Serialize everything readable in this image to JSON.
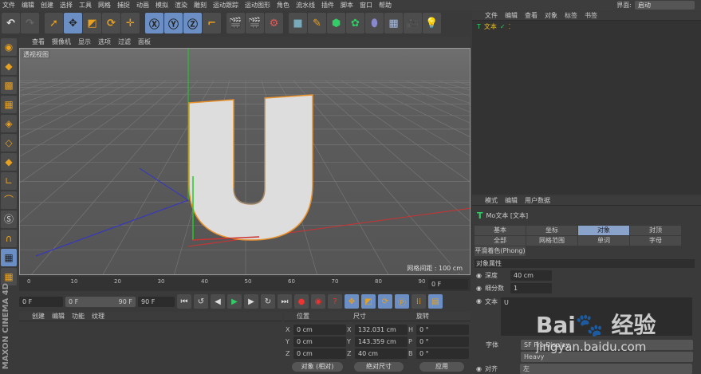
{
  "menu": [
    "文件",
    "编辑",
    "创建",
    "选择",
    "工具",
    "网格",
    "捕捉",
    "动画",
    "模拟",
    "渲染",
    "雕刻",
    "运动跟踪",
    "运动图形",
    "角色",
    "流水线",
    "插件",
    "脚本",
    "窗口",
    "帮助"
  ],
  "layout": {
    "label": "界面:",
    "value": "启动"
  },
  "viewport": {
    "menu": [
      "查看",
      "摄像机",
      "显示",
      "选项",
      "过滤",
      "面板"
    ],
    "name": "透视视图",
    "grid": "网格间距 : 100 cm"
  },
  "timeline": {
    "ticks": [
      "0",
      "10",
      "20",
      "30",
      "40",
      "50",
      "60",
      "70",
      "80",
      "90"
    ],
    "current": "0 F"
  },
  "playback": {
    "start": "0 F",
    "range_start": "0 F",
    "range_end": "90 F",
    "end": "90 F"
  },
  "material": {
    "menu": [
      "创建",
      "编辑",
      "功能",
      "纹理"
    ]
  },
  "coords": {
    "headers": [
      "位置",
      "尺寸",
      "旋转"
    ],
    "pos": [
      [
        "X",
        "0 cm"
      ],
      [
        "Y",
        "0 cm"
      ],
      [
        "Z",
        "0 cm"
      ]
    ],
    "size": [
      [
        "X",
        "132.031 cm"
      ],
      [
        "Y",
        "143.359 cm"
      ],
      [
        "Z",
        "40 cm"
      ]
    ],
    "rot": [
      [
        "H",
        "0 °"
      ],
      [
        "P",
        "0 °"
      ],
      [
        "B",
        "0 °"
      ]
    ],
    "mode": "对象 (相对)",
    "size_mode": "绝对尺寸",
    "apply": "应用"
  },
  "objects": {
    "menu": [
      "文件",
      "编辑",
      "查看",
      "对象",
      "标签",
      "书签"
    ],
    "item": "文本"
  },
  "attributes": {
    "menu": [
      "模式",
      "编辑",
      "用户数据"
    ],
    "title": "Mo文本 [文本]",
    "tabs": [
      "基本",
      "坐标",
      "对象",
      "封顶",
      "全部",
      "网格范围",
      "单词",
      "字母"
    ],
    "tab_extra": "平滑着色(Phong)",
    "section": "对象属性",
    "depth_label": "深度",
    "depth": "40 cm",
    "sub_label": "细分数",
    "sub": "1",
    "text_label": "文本",
    "text": "U",
    "font_label": "字体",
    "font": "SF Pro Display",
    "weight": "Heavy",
    "align_label": "对齐",
    "align": "左"
  },
  "watermark": "Bai du 经验 jingyan.baidu.com"
}
